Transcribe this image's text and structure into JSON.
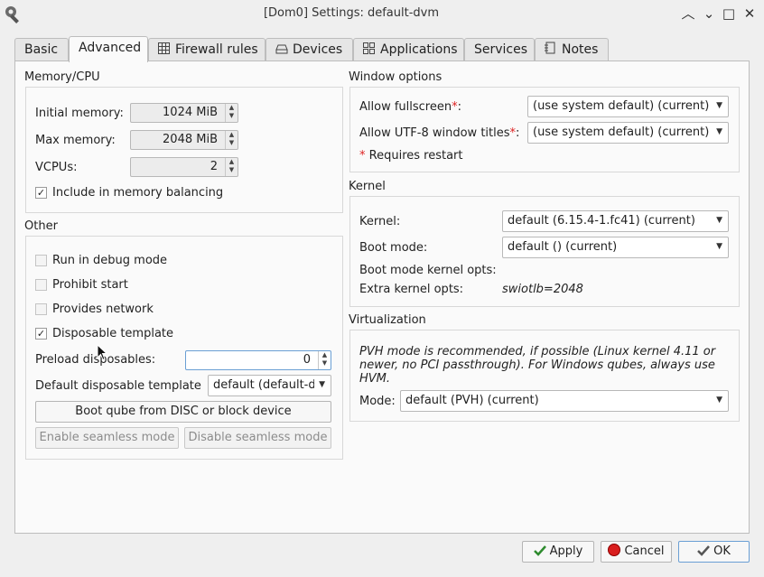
{
  "window": {
    "title": "[Dom0] Settings: default-dvm",
    "minimize": "︿",
    "restore": "⌄",
    "maximize": "□",
    "close": "✕"
  },
  "tabs": [
    {
      "label": "Basic"
    },
    {
      "label": "Advanced"
    },
    {
      "label": "Firewall rules"
    },
    {
      "label": "Devices"
    },
    {
      "label": "Applications"
    },
    {
      "label": "Services"
    },
    {
      "label": "Notes"
    }
  ],
  "memory_cpu": {
    "title": "Memory/CPU",
    "initial_memory_label": "Initial memory:",
    "initial_memory_value": "1024 MiB",
    "max_memory_label": "Max memory:",
    "max_memory_value": "2048 MiB",
    "vcpus_label": "VCPUs:",
    "vcpus_value": "2",
    "memory_balancing_label": "Include in memory balancing"
  },
  "other": {
    "title": "Other",
    "debug_label": "Run in debug mode",
    "prohibit_label": "Prohibit start",
    "network_label": "Provides network",
    "disposable_template_label": "Disposable template",
    "preload_label": "Preload disposables:",
    "preload_value": "0",
    "default_disp_label": "Default disposable template",
    "default_disp_value": "default (default-dvm) (current)",
    "boot_disc_label": "Boot qube from DISC or block device",
    "enable_seamless_label": "Enable seamless mode",
    "disable_seamless_label": "Disable seamless mode"
  },
  "window_options": {
    "title": "Window options",
    "fullscreen_label": "Allow fullscreen",
    "fullscreen_value": "(use system default) (current)",
    "utf8_label": "Allow UTF-8 window titles",
    "utf8_value": "(use system default) (current)",
    "asterisk": "*",
    "colon": ":",
    "requires_restart": "Requires restart"
  },
  "kernel": {
    "title": "Kernel",
    "kernel_label": "Kernel:",
    "kernel_value": "default (6.15.4-1.fc41) (current)",
    "boot_mode_label": "Boot mode:",
    "boot_mode_value": "default () (current)",
    "boot_mode_opts_label": "Boot mode kernel opts:",
    "extra_opts_label": "Extra kernel opts:",
    "extra_opts_value": "swiotlb=2048"
  },
  "virtualization": {
    "title": "Virtualization",
    "note": "PVH mode is recommended, if possible (Linux kernel 4.11 or newer, no PCI passthrough). For Windows qubes, always use HVM.",
    "mode_label": "Mode:",
    "mode_value": "default (PVH) (current)"
  },
  "footer": {
    "apply_label": "Apply",
    "cancel_label": "Cancel",
    "ok_label": "OK"
  }
}
